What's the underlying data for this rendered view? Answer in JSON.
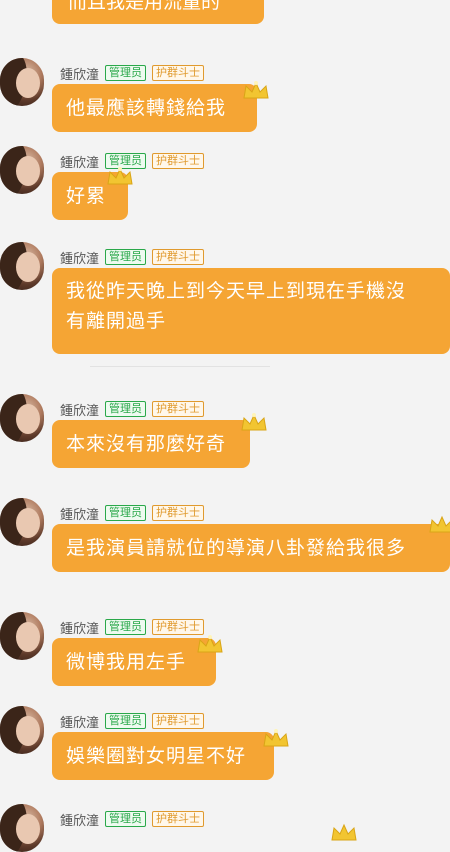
{
  "top_partial_message": "而且我是用流量的",
  "messages": [
    {
      "sender": "鍾欣潼",
      "badges": [
        "管理员",
        "护群斗士"
      ],
      "text": "他最應該轉錢給我"
    },
    {
      "sender": "鍾欣潼",
      "badges": [
        "管理员",
        "护群斗士"
      ],
      "text": "好累"
    },
    {
      "sender": "鍾欣潼",
      "badges": [
        "管理员",
        "护群斗士"
      ],
      "text": "我從昨天晚上到今天早上到現在手機沒",
      "text2": "有離開過手"
    },
    {
      "sender": "鍾欣潼",
      "badges": [
        "管理员",
        "护群斗士"
      ],
      "text": "本來沒有那麼好奇"
    },
    {
      "sender": "鍾欣潼",
      "badges": [
        "管理员",
        "护群斗士"
      ],
      "text": "是我演員請就位的導演八卦發給我很多"
    },
    {
      "sender": "鍾欣潼",
      "badges": [
        "管理员",
        "护群斗士"
      ],
      "text": "微博我用左手"
    },
    {
      "sender": "鍾欣潼",
      "badges": [
        "管理员",
        "护群斗士"
      ],
      "text": "娛樂圈對女明星不好"
    },
    {
      "sender": "鍾欣潼",
      "badges": [
        "管理员",
        "护群斗士"
      ],
      "text": ""
    }
  ],
  "colors": {
    "bubble": "#f5a534",
    "admin_badge": "#2aa84a",
    "guard_badge": "#e09a2e",
    "crown": "#f2c531"
  }
}
